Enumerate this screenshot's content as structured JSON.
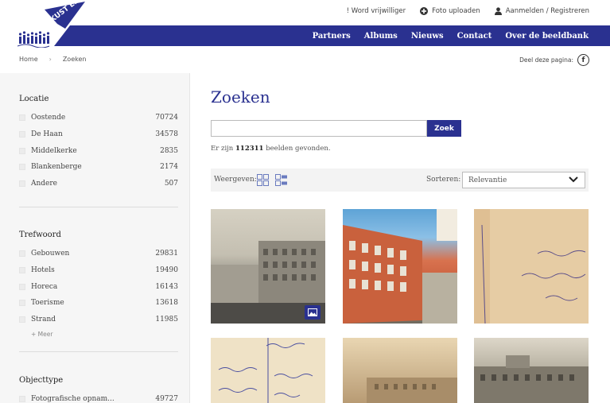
{
  "top_links": [
    {
      "label": "! Word vrijwilliger",
      "icon": ""
    },
    {
      "label": "Foto uploaden",
      "icon": "plus-circle-icon"
    },
    {
      "label": "Aanmelden / Registreren",
      "icon": "user-icon"
    }
  ],
  "logo": {
    "text": "KUST ERFGOED"
  },
  "nav": [
    "Partners",
    "Albums",
    "Nieuws",
    "Contact",
    "Over de beeldbank"
  ],
  "breadcrumb": {
    "home": "Home",
    "current": "Zoeken"
  },
  "share": {
    "label": "Deel deze pagina:",
    "icon": "facebook-icon"
  },
  "facets": [
    {
      "title": "Locatie",
      "items": [
        {
          "label": "Oostende",
          "count": "70724"
        },
        {
          "label": "De Haan",
          "count": "34578"
        },
        {
          "label": "Middelkerke",
          "count": "2835"
        },
        {
          "label": "Blankenberge",
          "count": "2174"
        },
        {
          "label": "Andere",
          "count": "507"
        }
      ]
    },
    {
      "title": "Trefwoord",
      "items": [
        {
          "label": "Gebouwen",
          "count": "29831"
        },
        {
          "label": "Hotels",
          "count": "19490"
        },
        {
          "label": "Horeca",
          "count": "16143"
        },
        {
          "label": "Toerisme",
          "count": "13618"
        },
        {
          "label": "Strand",
          "count": "11985"
        }
      ],
      "more": "+ Meer"
    },
    {
      "title": "Objecttype",
      "items": [
        {
          "label": "Fotografische opnam...",
          "count": "49727"
        }
      ]
    }
  ],
  "main": {
    "title": "Zoeken",
    "search_value": "",
    "search_button": "Zoek",
    "result_prefix": "Er zijn",
    "result_count": "112311",
    "result_suffix": "beelden gevonden.",
    "view_label": "Weergeven:",
    "sort_label": "Sorteren:",
    "sort_value": "Relevantie"
  },
  "colors": {
    "brand": "#2a3190",
    "sidebar_bg": "#f6f6f6"
  }
}
